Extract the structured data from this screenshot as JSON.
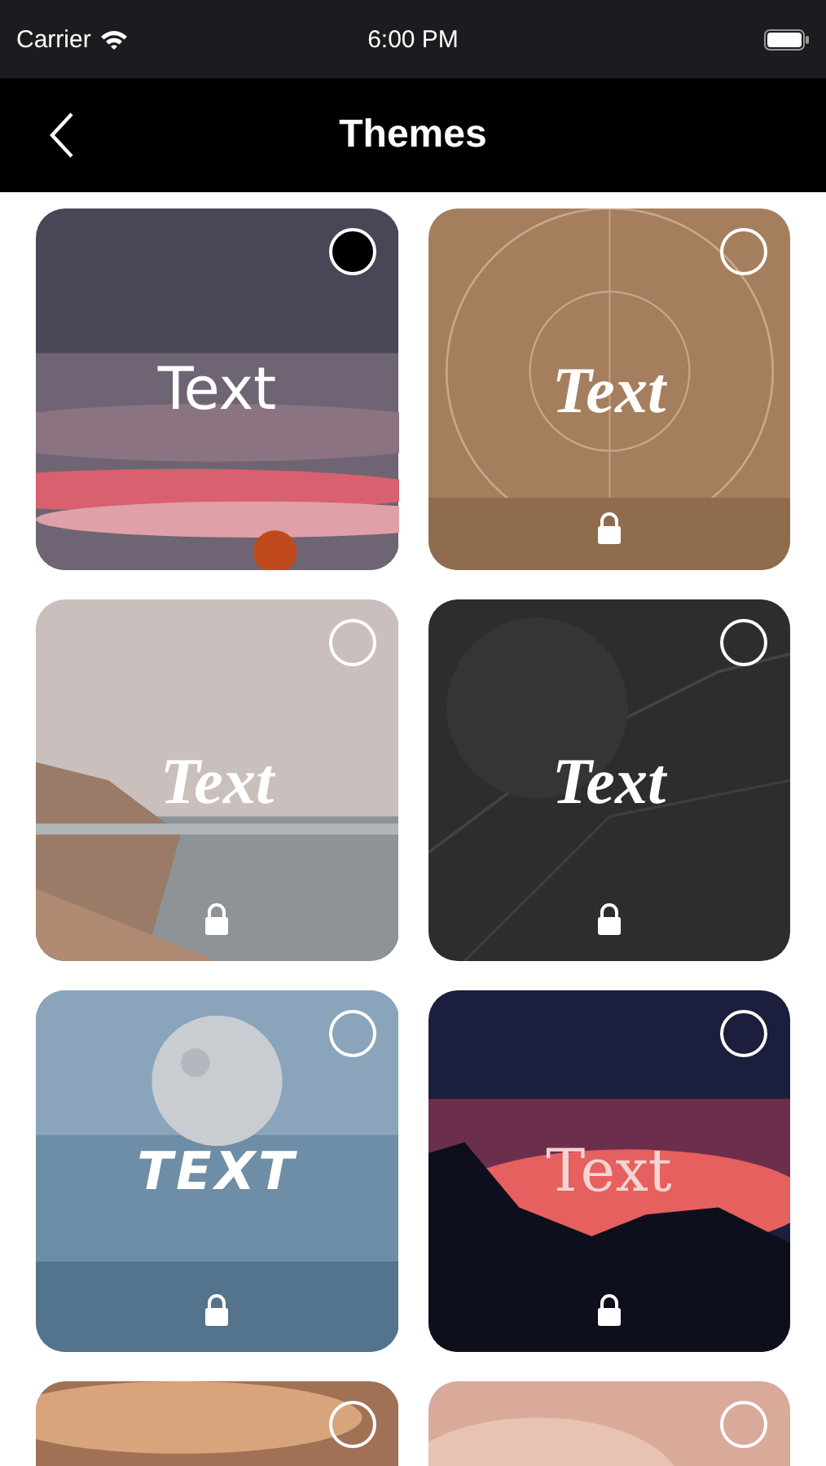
{
  "status_bar": {
    "carrier": "Carrier",
    "time": "6:00 PM"
  },
  "nav": {
    "title": "Themes"
  },
  "themes": [
    {
      "kind": "sans",
      "sample": "Text",
      "selected": true,
      "locked": false
    },
    {
      "kind": "script",
      "sample": "Text",
      "selected": false,
      "locked": true
    },
    {
      "kind": "script",
      "sample": "Text",
      "selected": false,
      "locked": true
    },
    {
      "kind": "script",
      "sample": "Text",
      "selected": false,
      "locked": true
    },
    {
      "kind": "slash",
      "sample": "TEXT",
      "selected": false,
      "locked": true
    },
    {
      "kind": "serif",
      "sample": "Text",
      "selected": false,
      "locked": true
    },
    {
      "kind": "blank",
      "selected": false
    },
    {
      "kind": "blank",
      "selected": false
    }
  ]
}
